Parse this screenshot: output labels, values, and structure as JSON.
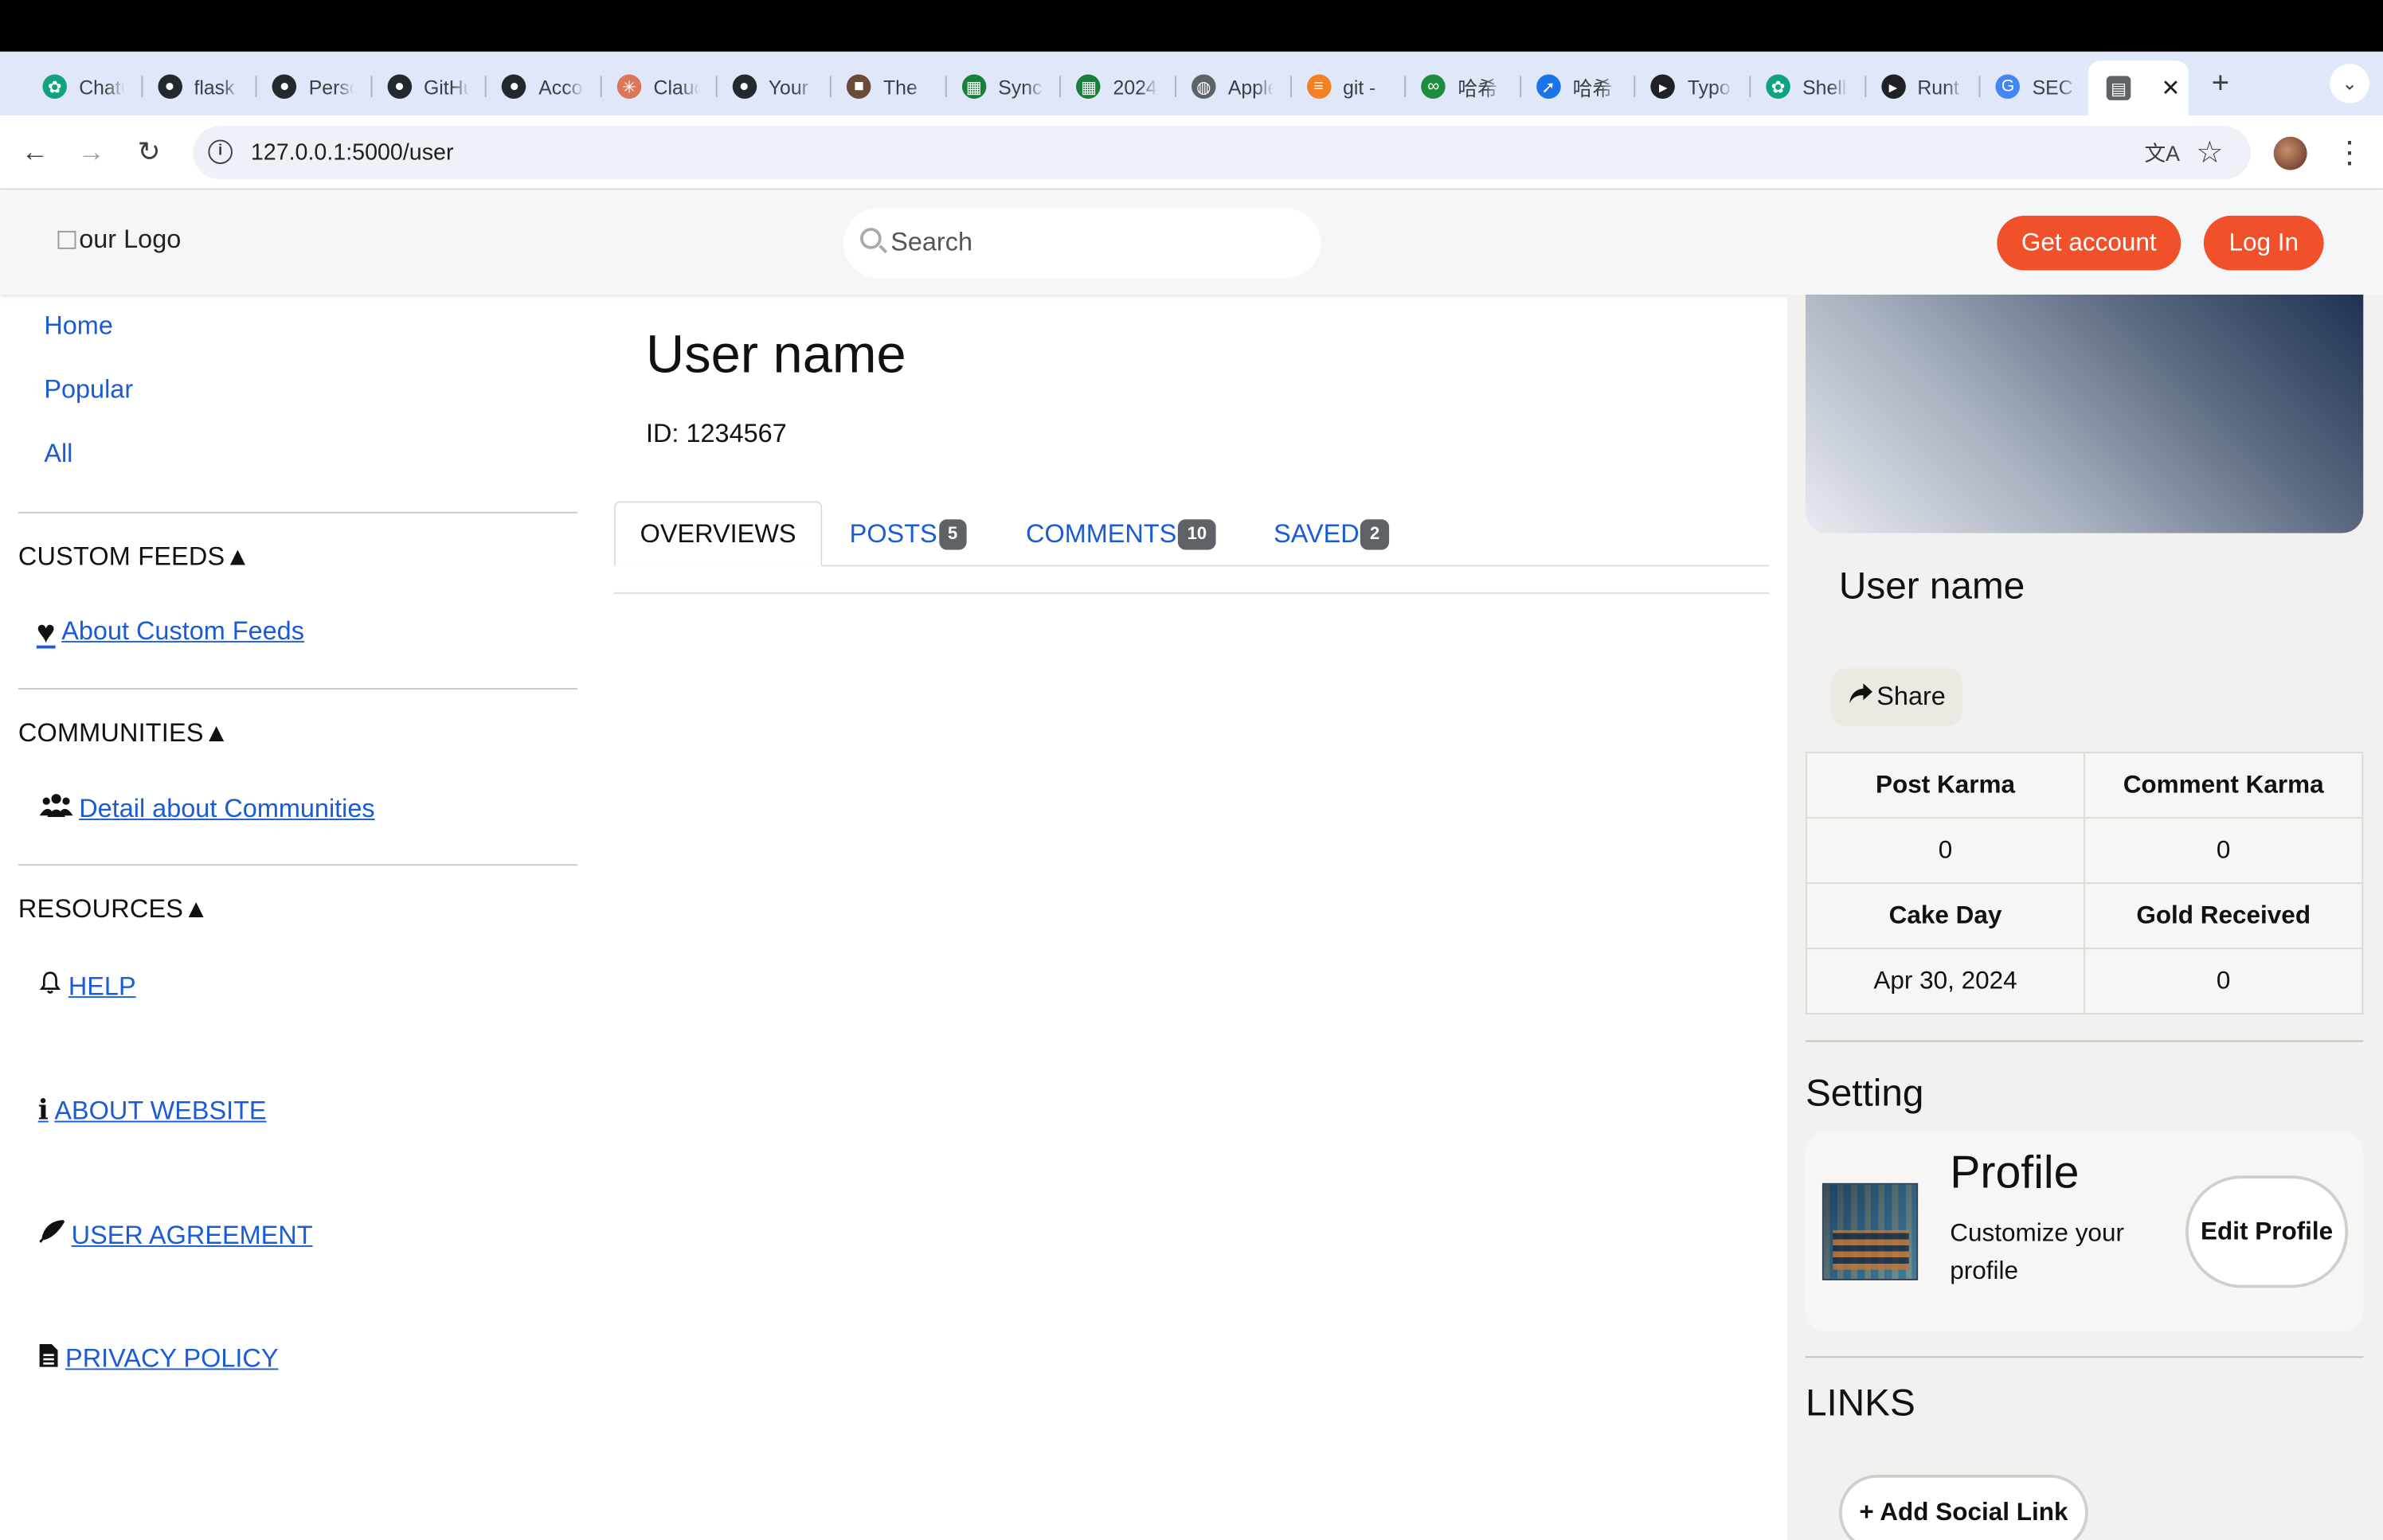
{
  "browser": {
    "tabs": [
      {
        "title": "ChatGPT",
        "icon": "openai-icon",
        "color": "#10a37f"
      },
      {
        "title": "flask",
        "icon": "github-icon",
        "color": "#24292f"
      },
      {
        "title": "Personal",
        "icon": "github-icon",
        "color": "#24292f"
      },
      {
        "title": "GitHub",
        "icon": "github-icon",
        "color": "#24292f"
      },
      {
        "title": "Account",
        "icon": "github-icon",
        "color": "#24292f"
      },
      {
        "title": "Claude",
        "icon": "claude-icon",
        "color": "#d97757"
      },
      {
        "title": "Your",
        "icon": "github-icon",
        "color": "#24292f"
      },
      {
        "title": "The",
        "icon": "portrait-icon",
        "color": "#6b4a3a"
      },
      {
        "title": "Sync",
        "icon": "sheet-icon",
        "color": "#188038"
      },
      {
        "title": "2024",
        "icon": "sheet-icon",
        "color": "#188038"
      },
      {
        "title": "Apple",
        "icon": "globe-icon",
        "color": "#5f6368"
      },
      {
        "title": "git -",
        "icon": "stackoverflow-icon",
        "color": "#f48024"
      },
      {
        "title": "哈希",
        "icon": "link-icon",
        "color": "#1e8e3e"
      },
      {
        "title": "哈希",
        "icon": "rocket-icon",
        "color": "#1a73e8"
      },
      {
        "title": "Typora",
        "icon": "terminal-icon",
        "color": "#202124"
      },
      {
        "title": "Shell",
        "icon": "openai-icon",
        "color": "#10a37f"
      },
      {
        "title": "Runt",
        "icon": "terminal-icon",
        "color": "#202124"
      },
      {
        "title": "SEC",
        "icon": "google-icon",
        "color": "#4285f4"
      }
    ],
    "active_tab_icon": "page-icon",
    "url": "127.0.0.1:5000/user"
  },
  "header": {
    "logo_alt": "our Logo",
    "search_placeholder": "Search",
    "get_account": "Get account",
    "log_in": "Log In",
    "accent_color": "#f0512a"
  },
  "sidebar": {
    "nav": [
      "Home",
      "Popular",
      "All"
    ],
    "custom_feeds": {
      "heading": "CUSTOM FEEDS",
      "toggle": "▲",
      "link": "About Custom Feeds",
      "icon": "heart-icon"
    },
    "communities": {
      "heading": "COMMUNITIES",
      "toggle": "▲",
      "link": "Detail about Communities",
      "icon": "users-icon"
    },
    "resources": {
      "heading": "RESOURCES",
      "toggle": "▲",
      "links": [
        {
          "label": "HELP",
          "icon": "bell-icon"
        },
        {
          "label": "ABOUT WEBSITE",
          "icon": "info-icon"
        },
        {
          "label": "USER AGREEMENT",
          "icon": "feather-icon"
        },
        {
          "label": "PRIVACY POLICY",
          "icon": "document-icon"
        }
      ]
    }
  },
  "main": {
    "title": "User name",
    "id_text": "ID: 1234567",
    "tabs": [
      {
        "label": "OVERVIEWS",
        "count": null
      },
      {
        "label": "POSTS",
        "count": "5"
      },
      {
        "label": "COMMENTS",
        "count": "10"
      },
      {
        "label": "SAVED",
        "count": "2"
      }
    ]
  },
  "profile_panel": {
    "name": "User name",
    "share": "Share",
    "stats": {
      "post_karma_label": "Post Karma",
      "comment_karma_label": "Comment Karma",
      "post_karma": "0",
      "comment_karma": "0",
      "cake_day_label": "Cake Day",
      "gold_label": "Gold Received",
      "cake_day": "Apr 30, 2024",
      "gold": "0"
    },
    "setting_heading": "Setting",
    "profile_title": "Profile",
    "profile_desc": "Customize your profile",
    "edit_profile": "Edit Profile",
    "links_heading": "LINKS",
    "add_social_link": "+ Add Social Link"
  }
}
